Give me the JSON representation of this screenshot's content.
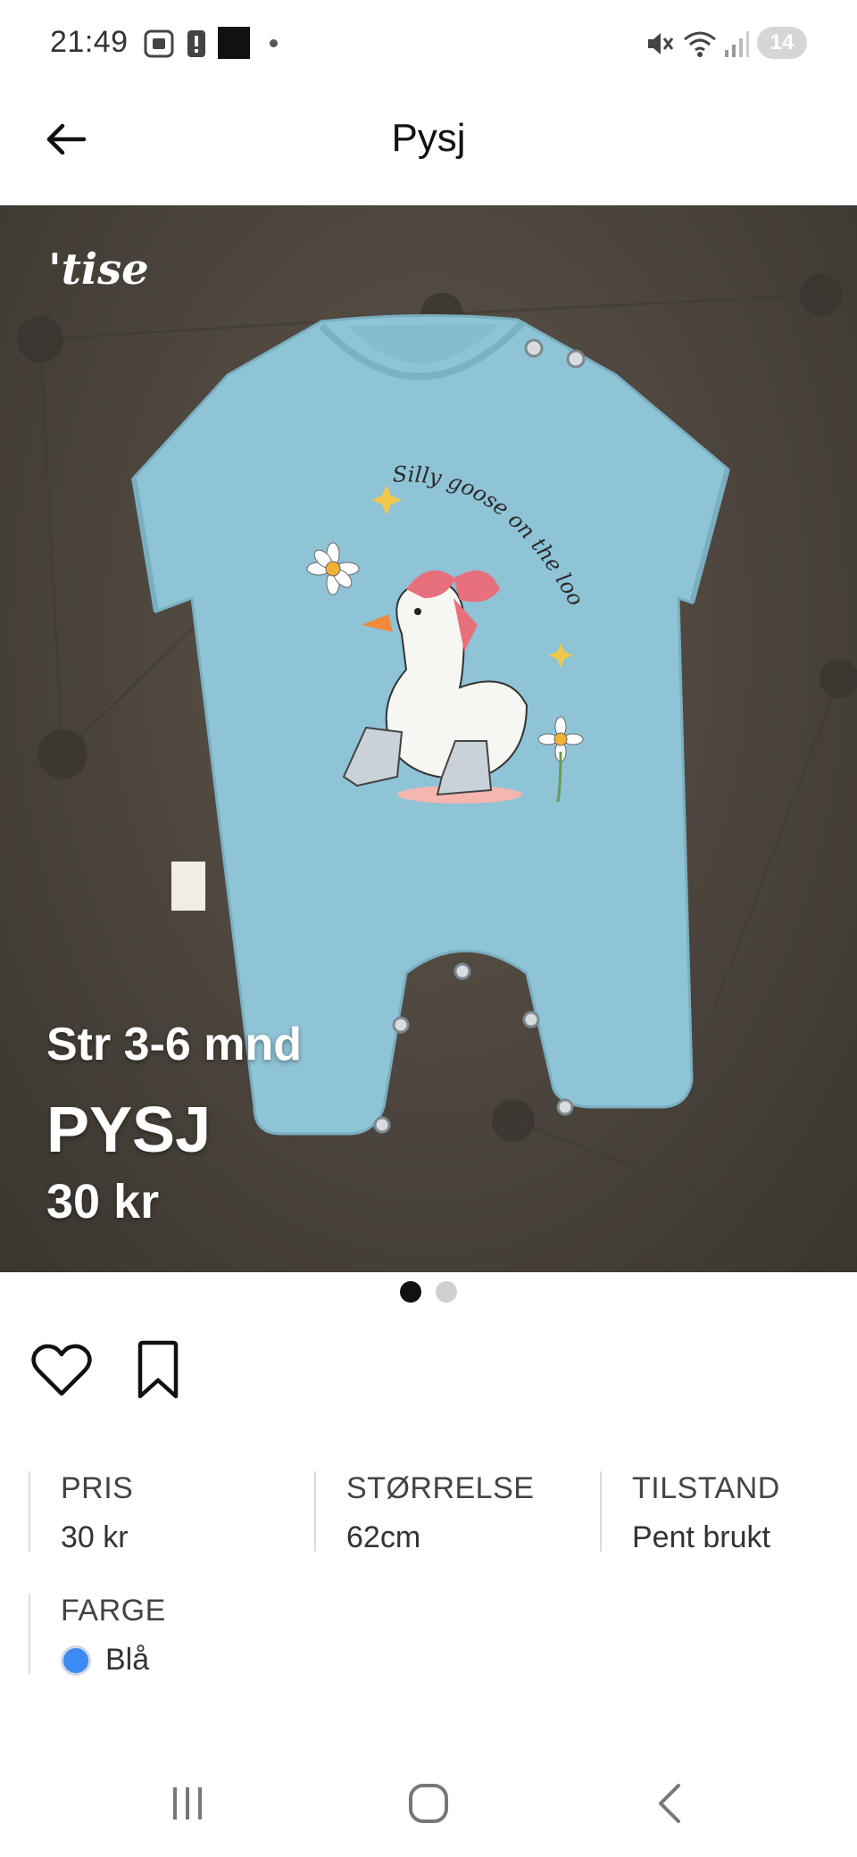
{
  "status_bar": {
    "time": "21:49",
    "badge": "14",
    "icons": [
      "screenshot-icon",
      "alert-icon",
      "app-thumbnail-icon",
      "notification-dot-icon",
      "mute-icon",
      "wifi-icon",
      "signal-icon"
    ]
  },
  "header": {
    "title": "Pysj",
    "back_icon": "arrow-left-icon"
  },
  "hero": {
    "brand": "'tise",
    "overlay": {
      "size": "Str 3-6 mnd",
      "title": "PYSJ",
      "price": "30 kr"
    },
    "garment_print_text": "Silly goose on the loose",
    "carousel": {
      "count": 2,
      "active": 1
    }
  },
  "actions": {
    "like_icon": "heart-icon",
    "save_icon": "bookmark-icon"
  },
  "details": {
    "price": {
      "label": "PRIS",
      "value": "30 kr"
    },
    "size": {
      "label": "STØRRELSE",
      "value": "62cm"
    },
    "condition": {
      "label": "TILSTAND",
      "value": "Pent brukt"
    },
    "color": {
      "label": "FARGE",
      "value": "Blå",
      "swatch": "#3d8bf5"
    }
  },
  "nav": {
    "recents_icon": "recents-icon",
    "home_icon": "home-icon",
    "back_icon": "nav-back-icon"
  },
  "colors": {
    "garment": "#8fc3d6",
    "background": "#4a443c",
    "accent_bow": "#e8707c"
  }
}
